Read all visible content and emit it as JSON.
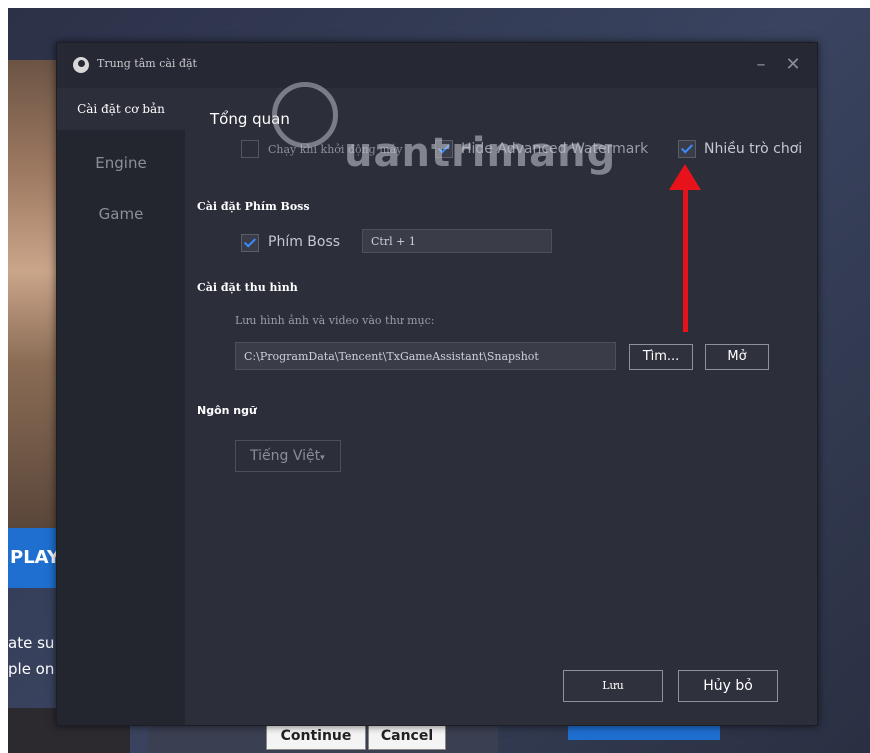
{
  "window": {
    "title": "Trung tâm cài đặt"
  },
  "sidebar": {
    "items": [
      {
        "label": "Cài đặt cơ bản",
        "active": true
      },
      {
        "label": "Engine",
        "active": false
      },
      {
        "label": "Game",
        "active": false
      }
    ]
  },
  "overview": {
    "heading": "Tổng quan",
    "options": [
      {
        "label": "Chạy khi khởi động máy",
        "checked": false
      },
      {
        "label": "Hide Advanced Watermark",
        "checked": true
      },
      {
        "label": "Nhiều trò chơi",
        "checked": true
      }
    ]
  },
  "boss": {
    "heading": "Cài đặt Phím Boss",
    "checkbox_label": "Phím Boss",
    "checked": true,
    "hotkey": "Ctrl + 1"
  },
  "capture": {
    "heading": "Cài đặt thu hình",
    "description": "Lưu hình ảnh và video vào thư mục:",
    "path": "C:\\ProgramData\\Tencent\\TxGameAssistant\\Snapshot",
    "browse_label": "Tìm...",
    "open_label": "Mở"
  },
  "language": {
    "heading": "Ngôn ngữ",
    "selected": "Tiếng Việt"
  },
  "footer": {
    "save_label": "Lưu",
    "cancel_label": "Hủy bỏ"
  },
  "background": {
    "play_label": "PLAY",
    "text_line1": "ate su",
    "text_line2": "ple on",
    "continue_label": "Continue",
    "cancel_label": "Cancel"
  },
  "watermark": "uantrimang",
  "colors": {
    "accent": "#3b8cff",
    "arrow": "#e8121a",
    "dialog_bg": "#2c2e3a"
  }
}
